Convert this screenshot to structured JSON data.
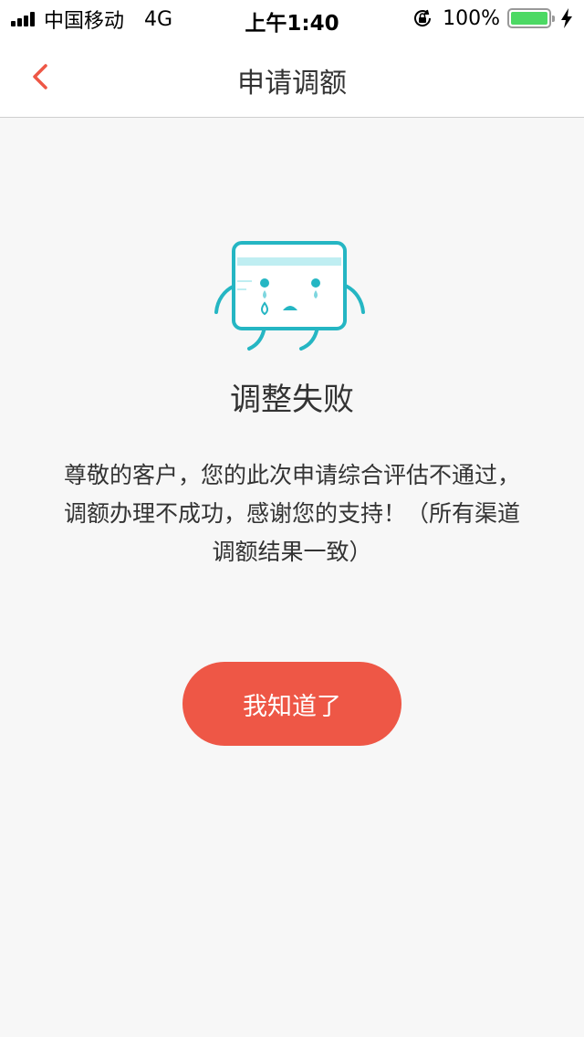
{
  "status_bar": {
    "carrier": "中国移动",
    "network": "4G",
    "time": "上午1:40",
    "battery": "100%",
    "battery_level": 1.0
  },
  "nav": {
    "title": "申请调额",
    "back_icon": "chevron-left-icon"
  },
  "result": {
    "illustration": "crying-card-icon",
    "title": "调整失败",
    "message": "尊敬的客户，您的此次申请综合评估不通过，调额办理不成功，感谢您的支持！（所有渠道调额结果一致）"
  },
  "actions": {
    "confirm_label": "我知道了"
  },
  "colors": {
    "accent": "#ee5746",
    "illustration": "#25b6c3",
    "background": "#f7f7f7"
  }
}
